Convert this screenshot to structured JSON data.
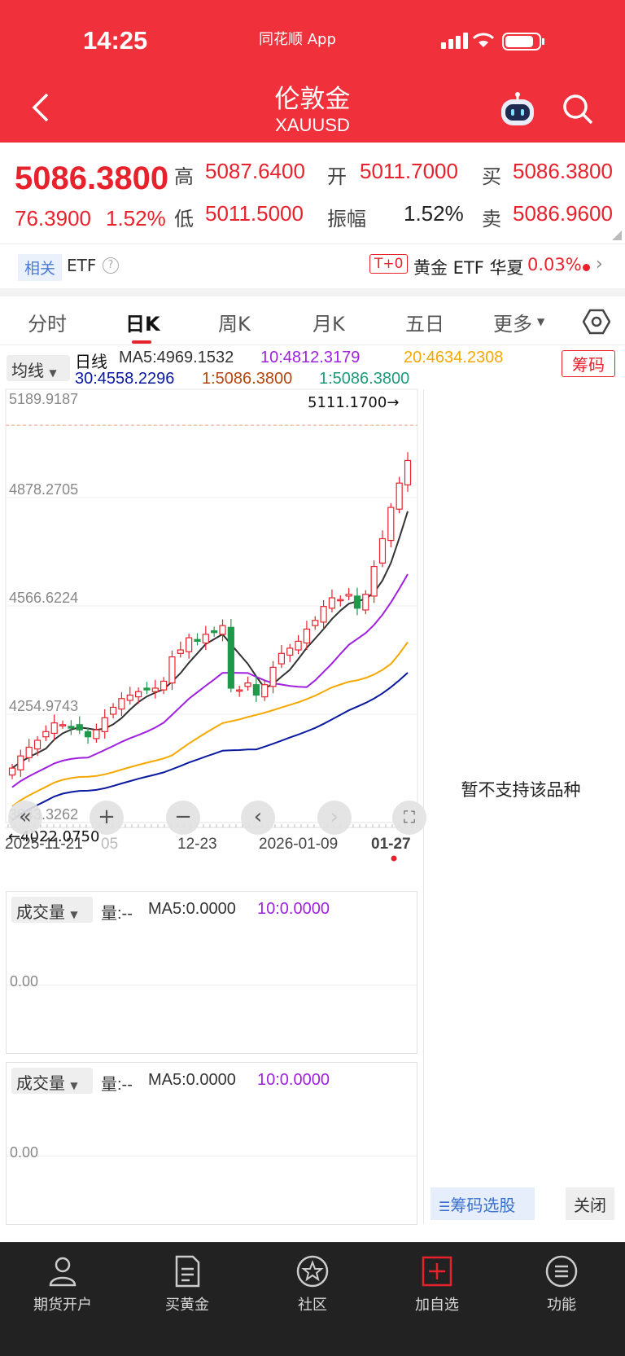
{
  "status": {
    "time": "14:25",
    "app": "同花顺 App"
  },
  "header": {
    "title": "伦敦金",
    "subtitle": "XAUUSD"
  },
  "quote": {
    "price": "5086.3800",
    "change": "76.3900",
    "change_pct": "1.52%",
    "labels": {
      "high": "高",
      "low": "低",
      "open": "开",
      "amp": "振幅",
      "buy": "买",
      "sell": "卖"
    },
    "high": "5087.6400",
    "low": "5011.5000",
    "open": "5011.7000",
    "amplitude": "1.52%",
    "buy": "5086.3800",
    "sell": "5086.9600"
  },
  "related": {
    "tag": "相关",
    "etf": "ETF",
    "t0": "T+0",
    "etf_name": "黄金 ETF 华夏",
    "etf_pct": "0.03%"
  },
  "tabs": [
    "分时",
    "日K",
    "周K",
    "月K",
    "五日",
    "更多"
  ],
  "indicators": {
    "ma_select": "均线",
    "line_label": "日线",
    "ma5": "MA5:4969.1532",
    "ma10": "10:4812.3179",
    "ma20": "20:4634.2308",
    "ma30": "30:4558.2296",
    "v1a": "1:5086.3800",
    "v1b": "1:5086.3800",
    "chip_button": "筹码",
    "colors": {
      "ma5": "#333333",
      "ma10": "#a020e0",
      "ma20": "#f5a800",
      "ma30": "#0a1aa0"
    }
  },
  "chart_data": {
    "type": "candlestick",
    "y_ticks": [
      "5189.9187",
      "4878.2705",
      "4566.6224",
      "4254.9743",
      "3943.3262"
    ],
    "max_marker": "5111.1700→",
    "min_marker": "←4022.0750",
    "x_ticks": [
      "2025-11-21",
      "05",
      "12-23",
      "2026-01-09",
      "01-27"
    ],
    "ylim": [
      3943.3262,
      5189.9187
    ],
    "last_close": 5086.38
  },
  "volume_panels": [
    {
      "select": "成交量",
      "vol": "量:--",
      "ma5": "MA5:0.0000",
      "ma10": "10:0.0000",
      "zero": "0.00"
    },
    {
      "select": "成交量",
      "vol": "量:--",
      "ma5": "MA5:0.0000",
      "ma10": "10:0.0000",
      "zero": "0.00"
    }
  ],
  "side_panel": {
    "message": "暂不支持该品种",
    "chip_select": "筹码选股",
    "close": "关闭"
  },
  "bottom_nav": [
    {
      "label": "期货开户",
      "icon": "person-icon"
    },
    {
      "label": "买黄金",
      "icon": "document-icon"
    },
    {
      "label": "社区",
      "icon": "star-icon"
    },
    {
      "label": "加自选",
      "icon": "add-icon"
    },
    {
      "label": "功能",
      "icon": "menu-icon"
    }
  ]
}
